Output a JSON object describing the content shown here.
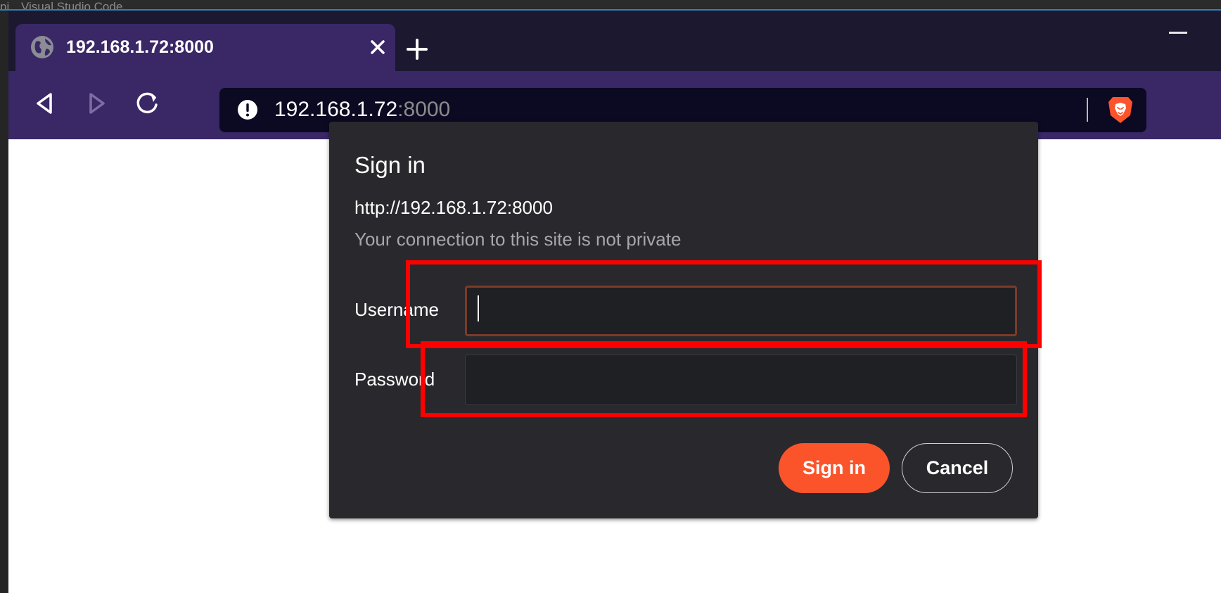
{
  "background_app": {
    "prefix": "pi",
    "title": "Visual Studio Code"
  },
  "browser": {
    "tab": {
      "title": "192.168.1.72:8000",
      "favicon": "globe-icon"
    },
    "new_tab": "plus-icon",
    "omnibox": {
      "host": "192.168.1.72",
      "port": ":8000",
      "security_icon": "warning-icon"
    },
    "shield_icon": "brave-lion-icon"
  },
  "dialog": {
    "title": "Sign in",
    "url": "http://192.168.1.72:8000",
    "note": "Your connection to this site is not private",
    "username_label": "Username",
    "username_value": "",
    "password_label": "Password",
    "password_value": "",
    "signin_label": "Sign in",
    "cancel_label": "Cancel"
  },
  "colors": {
    "accent": "#fb542b",
    "dialog_bg": "#29292d",
    "toolbar_bg": "#3a2766",
    "annotation": "#ff0000"
  }
}
